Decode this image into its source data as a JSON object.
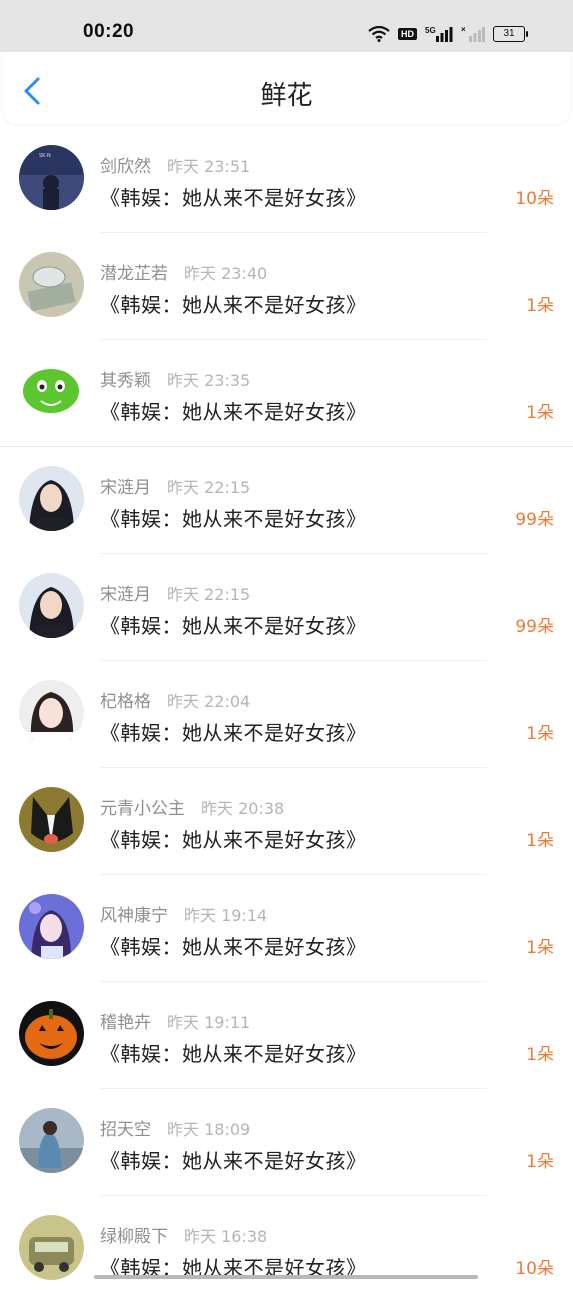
{
  "status_bar": {
    "time": "00:20",
    "hd": "HD",
    "network": "5G",
    "battery": "31"
  },
  "header": {
    "title": "鲜花",
    "back_icon": "chevron-left-icon"
  },
  "colors": {
    "accent": "#2a8ef0",
    "flower_count": "#ee7a36",
    "name": "#8f8f8f",
    "time": "#b5b5b5"
  },
  "items": [
    {
      "name": "剑欣然",
      "time": "昨天 23:51",
      "article": "《韩娱：她从来不是好女孩》",
      "count": "10朵"
    },
    {
      "name": "潜龙芷若",
      "time": "昨天 23:40",
      "article": "《韩娱：她从来不是好女孩》",
      "count": "1朵"
    },
    {
      "name": "其秀颖",
      "time": "昨天 23:35",
      "article": "《韩娱：她从来不是好女孩》",
      "count": "1朵"
    },
    {
      "name": "宋涟月",
      "time": "昨天 22:15",
      "article": "《韩娱：她从来不是好女孩》",
      "count": "99朵"
    },
    {
      "name": "宋涟月",
      "time": "昨天 22:15",
      "article": "《韩娱：她从来不是好女孩》",
      "count": "99朵"
    },
    {
      "name": "杞格格",
      "time": "昨天 22:04",
      "article": "《韩娱：她从来不是好女孩》",
      "count": "1朵"
    },
    {
      "name": "元青小公主",
      "time": "昨天 20:38",
      "article": "《韩娱：她从来不是好女孩》",
      "count": "1朵"
    },
    {
      "name": "风神康宁",
      "time": "昨天 19:14",
      "article": "《韩娱：她从来不是好女孩》",
      "count": "1朵"
    },
    {
      "name": "稽艳卉",
      "time": "昨天 19:11",
      "article": "《韩娱：她从来不是好女孩》",
      "count": "1朵"
    },
    {
      "name": "招天空",
      "time": "昨天 18:09",
      "article": "《韩娱：她从来不是好女孩》",
      "count": "1朵"
    },
    {
      "name": "绿柳殿下",
      "time": "昨天 16:38",
      "article": "《韩娱：她从来不是好女孩》",
      "count": "10朵"
    }
  ]
}
